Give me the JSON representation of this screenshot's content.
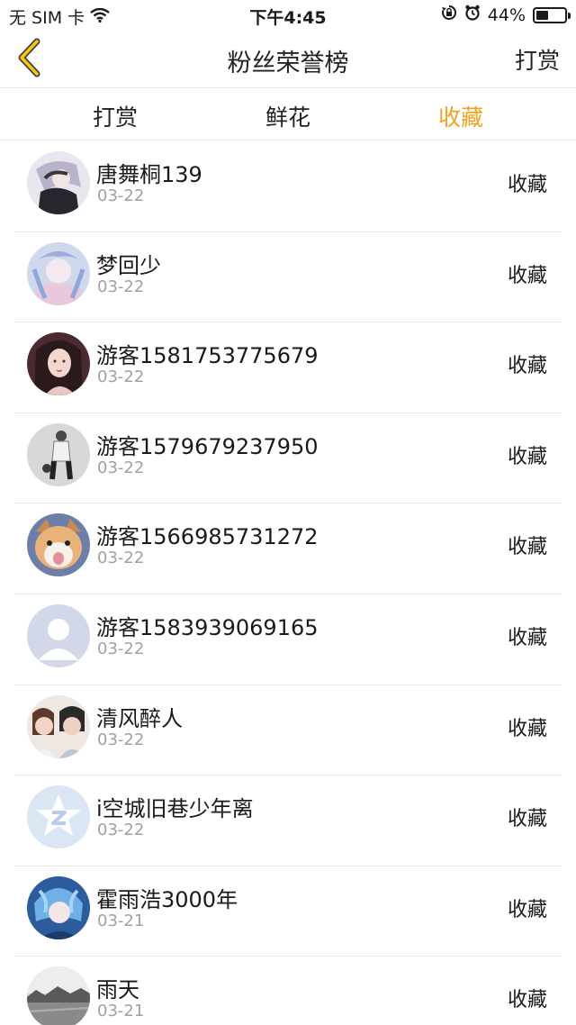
{
  "status_bar": {
    "carrier": "无 SIM 卡",
    "time": "下午4:45",
    "battery_text": "44%",
    "battery_level": 0.44
  },
  "nav": {
    "title": "粉丝荣誉榜",
    "right_label": "打赏",
    "accent_color": "#f0a31e"
  },
  "tabs": [
    {
      "label": "打赏",
      "active": false
    },
    {
      "label": "鲜花",
      "active": false
    },
    {
      "label": "收藏",
      "active": true
    }
  ],
  "fans": [
    {
      "name": "唐舞桐139",
      "date": "03-22",
      "action": "收藏",
      "avatar": "anime-girl-dark"
    },
    {
      "name": "梦回少",
      "date": "03-22",
      "action": "收藏",
      "avatar": "anime-girl-blue"
    },
    {
      "name": "游客1581753775679",
      "date": "03-22",
      "action": "收藏",
      "avatar": "girl-photo"
    },
    {
      "name": "游客1579679237950",
      "date": "03-22",
      "action": "收藏",
      "avatar": "figure-photo-gray"
    },
    {
      "name": "游客1566985731272",
      "date": "03-22",
      "action": "收藏",
      "avatar": "cat-photo"
    },
    {
      "name": "游客1583939069165",
      "date": "03-22",
      "action": "收藏",
      "avatar": "default-user"
    },
    {
      "name": "清风醉人",
      "date": "03-22",
      "action": "收藏",
      "avatar": "couple-photo"
    },
    {
      "name": "i空城旧巷少年离",
      "date": "03-22",
      "action": "收藏",
      "avatar": "qq-star-logo"
    },
    {
      "name": "霍雨浩3000年",
      "date": "03-21",
      "action": "收藏",
      "avatar": "anime-boy-blue"
    },
    {
      "name": "雨天",
      "date": "03-21",
      "action": "收藏",
      "avatar": "landscape-gray"
    }
  ]
}
